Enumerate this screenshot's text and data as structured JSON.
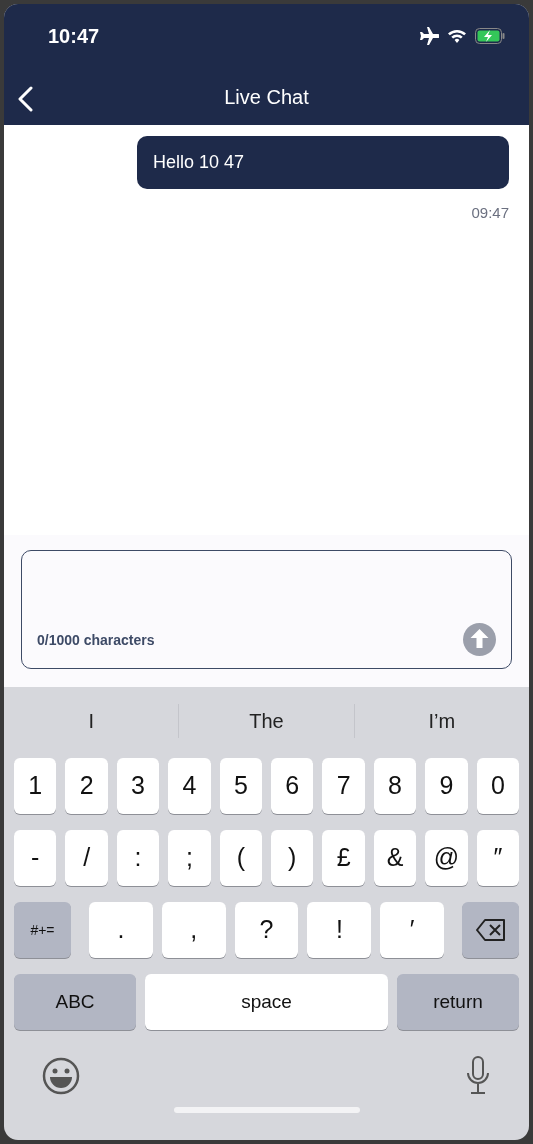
{
  "status_bar": {
    "time": "10:47"
  },
  "header": {
    "title": "Live Chat"
  },
  "messages": [
    {
      "kind": "outgoing",
      "text": "Hello 10 47",
      "time": "09:47"
    }
  ],
  "composer": {
    "counter": "0/1000 characters"
  },
  "keyboard": {
    "suggestions": [
      "I",
      "The",
      "I’m"
    ],
    "rows": [
      {
        "keys": [
          {
            "kind": "char",
            "label": "1"
          },
          {
            "kind": "char",
            "label": "2"
          },
          {
            "kind": "char",
            "label": "3"
          },
          {
            "kind": "char",
            "label": "4"
          },
          {
            "kind": "char",
            "label": "5"
          },
          {
            "kind": "char",
            "label": "6"
          },
          {
            "kind": "char",
            "label": "7"
          },
          {
            "kind": "char",
            "label": "8"
          },
          {
            "kind": "char",
            "label": "9"
          },
          {
            "kind": "char",
            "label": "0"
          }
        ]
      },
      {
        "keys": [
          {
            "kind": "char",
            "label": "-"
          },
          {
            "kind": "char",
            "label": "/"
          },
          {
            "kind": "char",
            "label": ":"
          },
          {
            "kind": "char",
            "label": ";"
          },
          {
            "kind": "char",
            "label": "("
          },
          {
            "kind": "char",
            "label": ")"
          },
          {
            "kind": "char",
            "label": "£"
          },
          {
            "kind": "char",
            "label": "&"
          },
          {
            "kind": "char",
            "label": "@"
          },
          {
            "kind": "char",
            "label": "″"
          }
        ]
      },
      {
        "keys": [
          {
            "kind": "function",
            "label": "#+="
          },
          {
            "kind": "wide",
            "label": "."
          },
          {
            "kind": "wide",
            "label": ","
          },
          {
            "kind": "wide",
            "label": "?"
          },
          {
            "kind": "wide",
            "label": "!"
          },
          {
            "kind": "wide",
            "label": "′"
          },
          {
            "kind": "delete"
          }
        ]
      },
      {
        "keys": [
          {
            "kind": "function",
            "label": "ABC"
          },
          {
            "kind": "space",
            "label": "space"
          },
          {
            "kind": "function",
            "label": "return"
          }
        ]
      }
    ]
  }
}
